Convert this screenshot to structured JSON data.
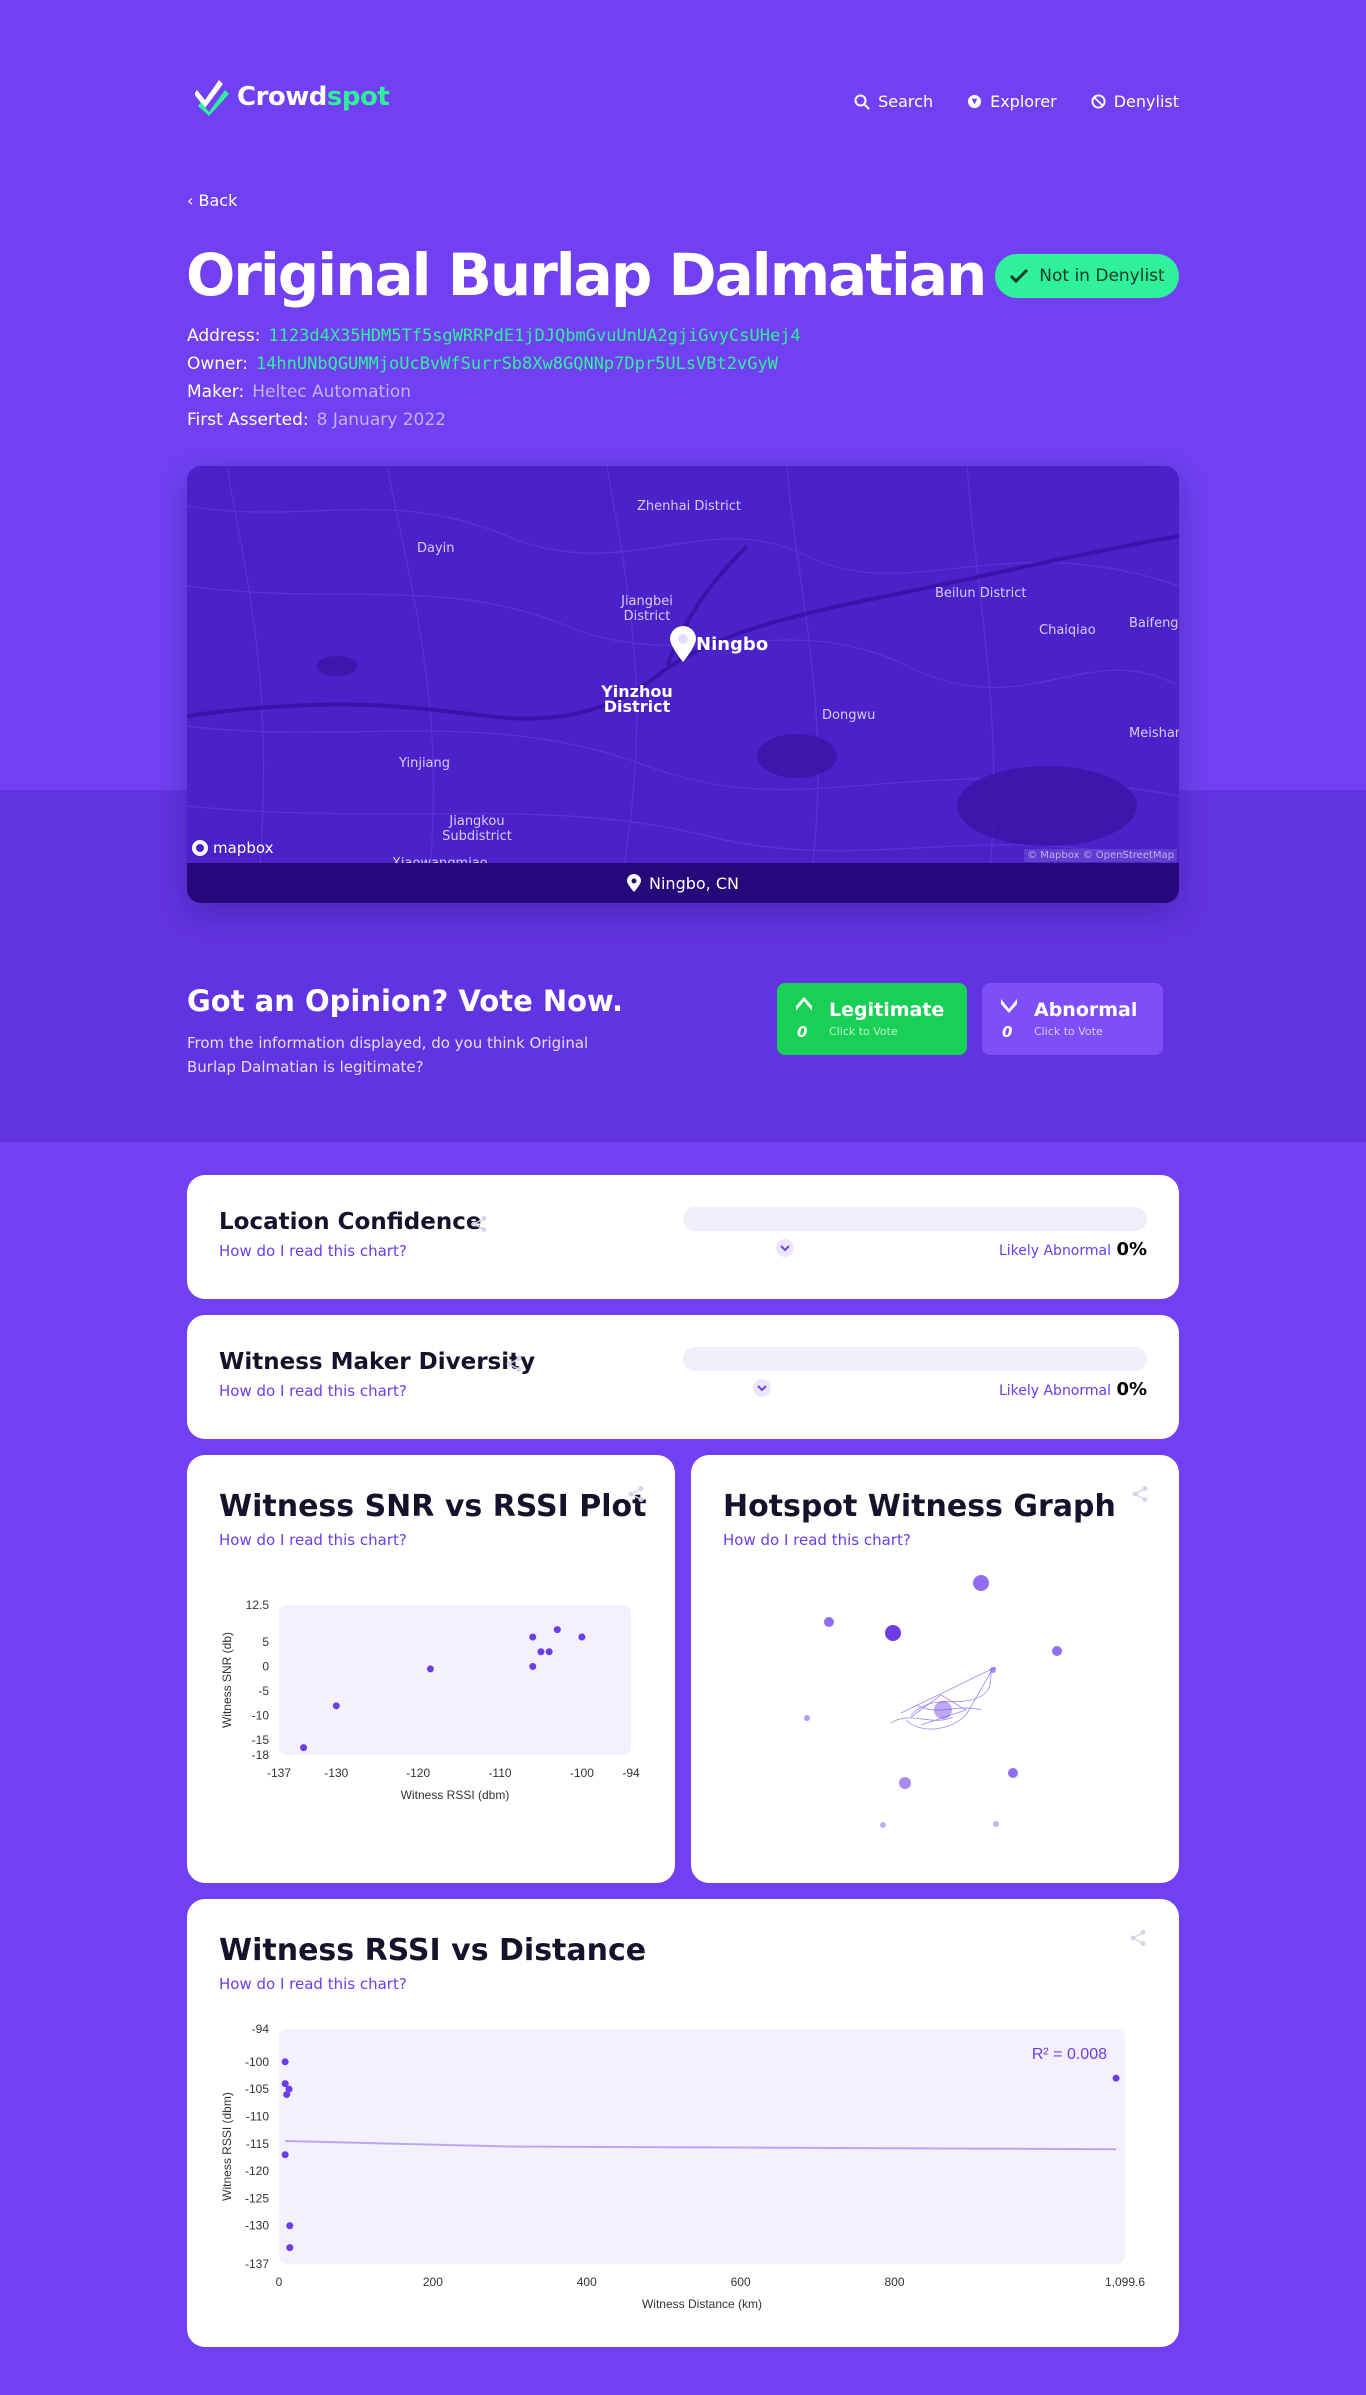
{
  "brand": {
    "name_a": "Crowd",
    "name_b": "spot",
    "accent": "#2ff09b",
    "primary": "#7040f2"
  },
  "nav": [
    {
      "label": "Search",
      "icon": "search-icon"
    },
    {
      "label": "Explorer",
      "icon": "compass-icon"
    },
    {
      "label": "Denylist",
      "icon": "ban-icon"
    }
  ],
  "back_label": "Back",
  "hotspot": {
    "name": "Original Burlap Dalmatian",
    "denylist_status": "Not in Denylist",
    "address_label": "Address:",
    "address": "1123d4X35HDM5Tf5sgWRRPdE1jDJQbmGvuUnUA2gjiGvyCsUHej4",
    "owner_label": "Owner:",
    "owner": "14hnUNbQGUMMjoUcBvWfSurrSb8Xw8GQNNp7Dpr5ULsVBt2vGyW",
    "maker_label": "Maker:",
    "maker": "Heltec Automation",
    "asserted_label": "First Asserted:",
    "asserted": "8 January 2022"
  },
  "map": {
    "location": "Ningbo, CN",
    "pin_label": "Ningbo",
    "labels": {
      "zhenhai": "Zhenhai District",
      "dayin": "Dayin",
      "jiangbei": "Jiangbei District",
      "beilun": "Beilun District",
      "chaiqiao": "Chaiqiao",
      "baifeng": "Baifeng",
      "yinzhou": "Yinzhou District",
      "dongwu": "Dongwu",
      "meishan": "Meishan",
      "yinjiang": "Yinjiang",
      "jiangkou": "Jiangkou Subdistrict",
      "xiaowangmiao": "Xiaowangmiao"
    },
    "provider": "mapbox",
    "attribution": "© Mapbox © OpenStreetMap"
  },
  "vote": {
    "heading": "Got an Opinion? Vote Now.",
    "text": "From the information displayed, do you think Original Burlap Dalmatian is legitimate?",
    "legit_label": "Legitimate",
    "legit_sub": "Click to Vote",
    "legit_count": "0",
    "abn_label": "Abnormal",
    "abn_sub": "Click to Vote",
    "abn_count": "0"
  },
  "howto": "How do I read this chart?",
  "location_confidence": {
    "title": "Location Confidence",
    "verdict": "Likely Abnormal",
    "percent": "0%",
    "level": 0.22
  },
  "maker_diversity": {
    "title": "Witness Maker Diversity",
    "verdict": "Likely Abnormal",
    "percent": "0%",
    "level": 0.17
  },
  "snr_title": "Witness SNR vs RSSI Plot",
  "graph_title": "Hotspot Witness Graph",
  "dist_title": "Witness RSSI vs Distance",
  "chart_data": [
    {
      "type": "scatter",
      "title": "Witness SNR vs RSSI Plot",
      "xlabel": "Witness RSSI (dbm)",
      "ylabel": "Witness SNR (db)",
      "xlim": [
        -137,
        -94
      ],
      "ylim": [
        -18,
        12.5
      ],
      "xticks": [
        "-137",
        "-130",
        "-120",
        "-110",
        "-100",
        "-94"
      ],
      "xtick_values": [
        -137,
        -130,
        -120,
        -110,
        -100,
        -94
      ],
      "yticks": [
        "12.5",
        "5",
        "0",
        "-5",
        "-10",
        "-15",
        "-18"
      ],
      "ytick_values": [
        12.5,
        5,
        0,
        -5,
        -10,
        -15,
        -18
      ],
      "points": [
        {
          "x": -134,
          "y": -16.5
        },
        {
          "x": -130,
          "y": -8
        },
        {
          "x": -118.5,
          "y": -0.5
        },
        {
          "x": -106,
          "y": 6
        },
        {
          "x": -106,
          "y": 0
        },
        {
          "x": -105,
          "y": 3
        },
        {
          "x": -104,
          "y": 3
        },
        {
          "x": -103,
          "y": 7.5
        },
        {
          "x": -100,
          "y": 6
        }
      ]
    },
    {
      "type": "scatter",
      "title": "Witness RSSI vs Distance",
      "xlabel": "Witness Distance (km)",
      "ylabel": "Witness RSSI (dbm)",
      "xlim": [
        0,
        1099.6
      ],
      "ylim": [
        -137,
        -94
      ],
      "xticks": [
        "0",
        "200",
        "400",
        "600",
        "800",
        "1,099.6"
      ],
      "xtick_values": [
        0,
        200,
        400,
        600,
        800,
        1099.6
      ],
      "yticks": [
        "-94",
        "-100",
        "-105",
        "-110",
        "-115",
        "-120",
        "-125",
        "-130",
        "-137"
      ],
      "ytick_values": [
        -94,
        -100,
        -105,
        -110,
        -115,
        -120,
        -125,
        -130,
        -137
      ],
      "r2_label": "R² = 0.008",
      "points": [
        {
          "x": 8,
          "y": -100
        },
        {
          "x": 8,
          "y": -104
        },
        {
          "x": 13,
          "y": -105
        },
        {
          "x": 10,
          "y": -106
        },
        {
          "x": 8,
          "y": -117
        },
        {
          "x": 14,
          "y": -130
        },
        {
          "x": 14,
          "y": -134
        },
        {
          "x": 1088,
          "y": -103
        }
      ],
      "trend": [
        {
          "x": 8,
          "y": -114.5
        },
        {
          "x": 300,
          "y": -115.5
        },
        {
          "x": 1088,
          "y": -116
        }
      ]
    }
  ]
}
